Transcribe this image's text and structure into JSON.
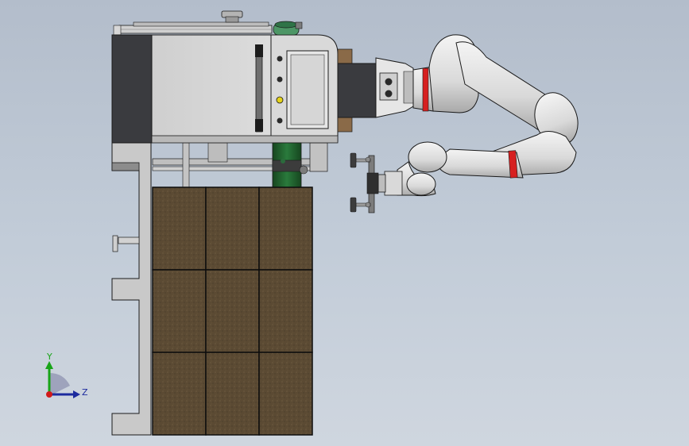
{
  "viewport": {
    "background_top": "#b3bdcb",
    "background_bottom": "#cfd6df"
  },
  "model": {
    "components": [
      "machine-frame",
      "vending-cabinet",
      "control-panel-screen",
      "cardboard-box-stack",
      "green-vertical-shaft",
      "robotic-arm",
      "vacuum-gripper"
    ],
    "box_grid": {
      "rows": 3,
      "cols": 3
    },
    "colors": {
      "frame": "#c8c8c8",
      "cabinet": "#d4d4d4",
      "cabinet_dark_panel": "#3a3b3f",
      "box": "#5b4a33",
      "shaft": "#1f5e2f",
      "arm": "#dcdcdc",
      "arm_ring": "#d62020",
      "status_led": "#e4d21a"
    }
  },
  "triad": {
    "y_label": "Y",
    "z_label": "Z",
    "y_color": "#18a418",
    "z_color": "#1c2a9e",
    "origin_color": "#d11a1a"
  }
}
